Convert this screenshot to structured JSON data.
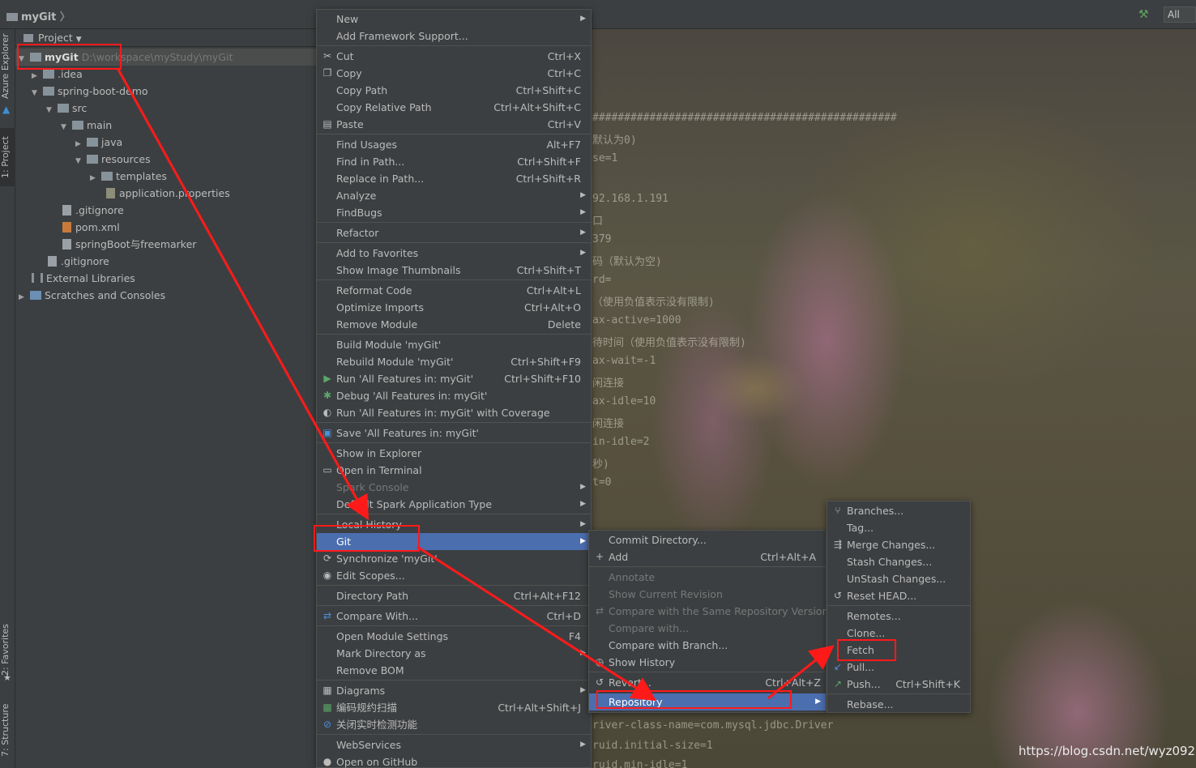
{
  "window": {
    "title": "myGit",
    "all_label": "All"
  },
  "sidestrip": {
    "azure": "Azure Explorer",
    "project": "1: Project",
    "favorites": "2: Favorites",
    "structure": "7: Structure"
  },
  "project_panel": {
    "header": "Project",
    "tree": [
      {
        "label": "myGit",
        "path": "D:\\workspace\\myStudy\\myGit"
      },
      {
        "label": ".idea"
      },
      {
        "label": "spring-boot-demo"
      },
      {
        "label": "src"
      },
      {
        "label": "main"
      },
      {
        "label": "java"
      },
      {
        "label": "resources"
      },
      {
        "label": "templates"
      },
      {
        "label": "application.properties"
      },
      {
        "label": ".gitignore"
      },
      {
        "label": "pom.xml"
      },
      {
        "label": "springBoot与freemarker"
      },
      {
        "label": ".gitignore"
      },
      {
        "label": "External Libraries"
      },
      {
        "label": "Scratches and Consoles"
      }
    ]
  },
  "editor_lines": [
    "################################################",
    "默认为0)",
    "se=1",
    "92.168.1.191",
    "口",
    "379",
    "码（默认为空)",
    "rd=",
    "（使用负值表示没有限制)",
    "ax-active=1000",
    "待时间（使用负值表示没有限制)",
    "ax-wait=-1",
    "闲连接",
    "ax-idle=10",
    "闲连接",
    "in-idle=2",
    "秒)",
    "t=0",
    "river-class-name=com.mysql.jdbc.Driver",
    "ruid.initial-size=1",
    "ruid.min-idle=1"
  ],
  "context_menu": {
    "items": [
      {
        "label": "New",
        "shortcut": ""
      },
      {
        "label": "Add Framework Support...",
        "shortcut": ""
      },
      {
        "label": "Cut",
        "shortcut": "Ctrl+X"
      },
      {
        "label": "Copy",
        "shortcut": "Ctrl+C"
      },
      {
        "label": "Copy Path",
        "shortcut": "Ctrl+Shift+C"
      },
      {
        "label": "Copy Relative Path",
        "shortcut": "Ctrl+Alt+Shift+C"
      },
      {
        "label": "Paste",
        "shortcut": "Ctrl+V"
      },
      {
        "label": "Find Usages",
        "shortcut": "Alt+F7"
      },
      {
        "label": "Find in Path...",
        "shortcut": "Ctrl+Shift+F"
      },
      {
        "label": "Replace in Path...",
        "shortcut": "Ctrl+Shift+R"
      },
      {
        "label": "Analyze",
        "shortcut": ""
      },
      {
        "label": "FindBugs",
        "shortcut": ""
      },
      {
        "label": "Refactor",
        "shortcut": ""
      },
      {
        "label": "Add to Favorites",
        "shortcut": ""
      },
      {
        "label": "Show Image Thumbnails",
        "shortcut": "Ctrl+Shift+T"
      },
      {
        "label": "Reformat Code",
        "shortcut": "Ctrl+Alt+L"
      },
      {
        "label": "Optimize Imports",
        "shortcut": "Ctrl+Alt+O"
      },
      {
        "label": "Remove Module",
        "shortcut": "Delete"
      },
      {
        "label": "Build Module 'myGit'",
        "shortcut": ""
      },
      {
        "label": "Rebuild Module 'myGit'",
        "shortcut": "Ctrl+Shift+F9"
      },
      {
        "label": "Run 'All Features in: myGit'",
        "shortcut": "Ctrl+Shift+F10"
      },
      {
        "label": "Debug 'All Features in: myGit'",
        "shortcut": ""
      },
      {
        "label": "Run 'All Features in: myGit' with Coverage",
        "shortcut": ""
      },
      {
        "label": "Save 'All Features in: myGit'",
        "shortcut": ""
      },
      {
        "label": "Show in Explorer",
        "shortcut": ""
      },
      {
        "label": "Open in Terminal",
        "shortcut": ""
      },
      {
        "label": "Spark Console",
        "shortcut": ""
      },
      {
        "label": "Default Spark Application Type",
        "shortcut": ""
      },
      {
        "label": "Local History",
        "shortcut": ""
      },
      {
        "label": "Git",
        "shortcut": ""
      },
      {
        "label": "Synchronize 'myGit'",
        "shortcut": ""
      },
      {
        "label": "Edit Scopes...",
        "shortcut": ""
      },
      {
        "label": "Directory Path",
        "shortcut": "Ctrl+Alt+F12"
      },
      {
        "label": "Compare With...",
        "shortcut": "Ctrl+D"
      },
      {
        "label": "Open Module Settings",
        "shortcut": "F4"
      },
      {
        "label": "Mark Directory as",
        "shortcut": ""
      },
      {
        "label": "Remove BOM",
        "shortcut": ""
      },
      {
        "label": "Diagrams",
        "shortcut": ""
      },
      {
        "label": "编码规约扫描",
        "shortcut": "Ctrl+Alt+Shift+J"
      },
      {
        "label": "关闭实时检测功能",
        "shortcut": ""
      },
      {
        "label": "WebServices",
        "shortcut": ""
      },
      {
        "label": "Open on GitHub",
        "shortcut": ""
      }
    ]
  },
  "git_menu": {
    "items": [
      {
        "label": "Commit Directory...",
        "shortcut": ""
      },
      {
        "label": "Add",
        "shortcut": "Ctrl+Alt+A"
      },
      {
        "label": "Annotate",
        "shortcut": ""
      },
      {
        "label": "Show Current Revision",
        "shortcut": ""
      },
      {
        "label": "Compare with the Same Repository Version",
        "shortcut": ""
      },
      {
        "label": "Compare with...",
        "shortcut": ""
      },
      {
        "label": "Compare with Branch...",
        "shortcut": ""
      },
      {
        "label": "Show History",
        "shortcut": ""
      },
      {
        "label": "Revert...",
        "shortcut": "Ctrl+Alt+Z"
      },
      {
        "label": "Repository",
        "shortcut": ""
      }
    ]
  },
  "repo_menu": {
    "items": [
      {
        "label": "Branches...",
        "shortcut": ""
      },
      {
        "label": "Tag...",
        "shortcut": ""
      },
      {
        "label": "Merge Changes...",
        "shortcut": ""
      },
      {
        "label": "Stash Changes...",
        "shortcut": ""
      },
      {
        "label": "UnStash Changes...",
        "shortcut": ""
      },
      {
        "label": "Reset HEAD...",
        "shortcut": ""
      },
      {
        "label": "Remotes...",
        "shortcut": ""
      },
      {
        "label": "Clone...",
        "shortcut": ""
      },
      {
        "label": "Fetch",
        "shortcut": ""
      },
      {
        "label": "Pull...",
        "shortcut": ""
      },
      {
        "label": "Push...",
        "shortcut": "Ctrl+Shift+K"
      },
      {
        "label": "Rebase...",
        "shortcut": ""
      }
    ]
  },
  "watermark": "https://blog.csdn.net/wyz0923",
  "colors": {
    "highlight": "#4b6eaf",
    "annotation": "#ff1a1a",
    "menu_bg": "#3c3f41"
  }
}
